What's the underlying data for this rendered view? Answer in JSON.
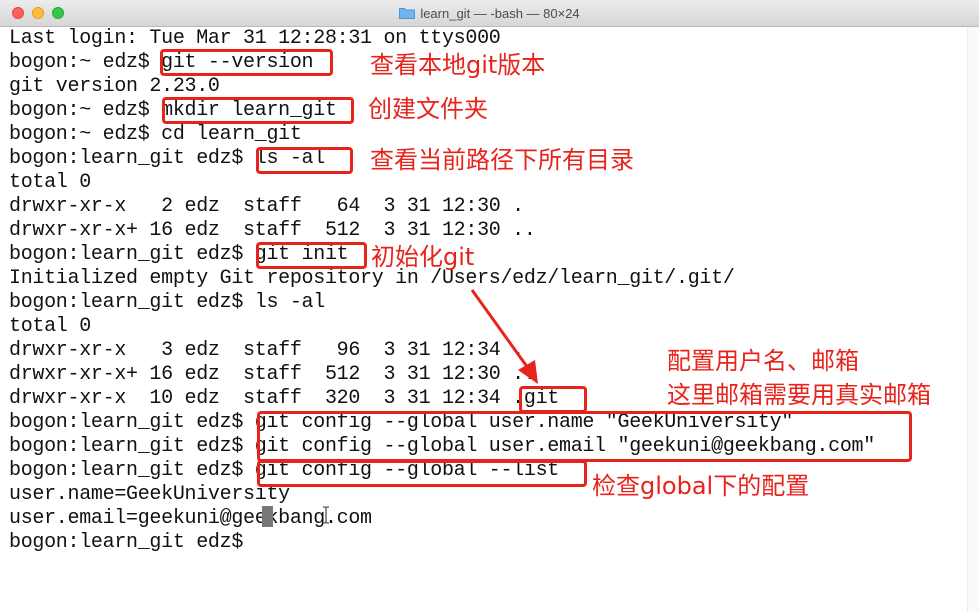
{
  "window": {
    "title": "learn_git — -bash — 80×24"
  },
  "terminal": {
    "lines": [
      "Last login: Tue Mar 31 12:28:31 on ttys000",
      "bogon:~ edz$ git --version",
      "git version 2.23.0",
      "bogon:~ edz$ mkdir learn_git",
      "bogon:~ edz$ cd learn_git",
      "bogon:learn_git edz$ ls -al",
      "total 0",
      "drwxr-xr-x   2 edz  staff   64  3 31 12:30 .",
      "drwxr-xr-x+ 16 edz  staff  512  3 31 12:30 ..",
      "bogon:learn_git edz$ git init",
      "Initialized empty Git repository in /Users/edz/learn_git/.git/",
      "bogon:learn_git edz$ ls -al",
      "total 0",
      "drwxr-xr-x   3 edz  staff   96  3 31 12:34 .",
      "drwxr-xr-x+ 16 edz  staff  512  3 31 12:30 ..",
      "drwxr-xr-x  10 edz  staff  320  3 31 12:34 .git",
      "bogon:learn_git edz$ git config --global user.name \"GeekUniversity\"",
      "bogon:learn_git edz$ git config --global user.email \"geekuni@geekbang.com\"",
      "bogon:learn_git edz$ git config --global --list",
      "user.name=GeekUniversity",
      "user.email=geekuni@geekbang.com",
      "bogon:learn_git edz$"
    ]
  },
  "annotations": {
    "version": "查看本地git版本",
    "mkdir": "创建文件夹",
    "ls": "查看当前路径下所有目录",
    "init": "初始化git",
    "config1": "配置用户名、邮箱",
    "config2": "这里邮箱需要用真实邮箱",
    "list": "检查global下的配置"
  },
  "colors": {
    "annotation": "#e8231b",
    "terminal_text": "#111111"
  }
}
